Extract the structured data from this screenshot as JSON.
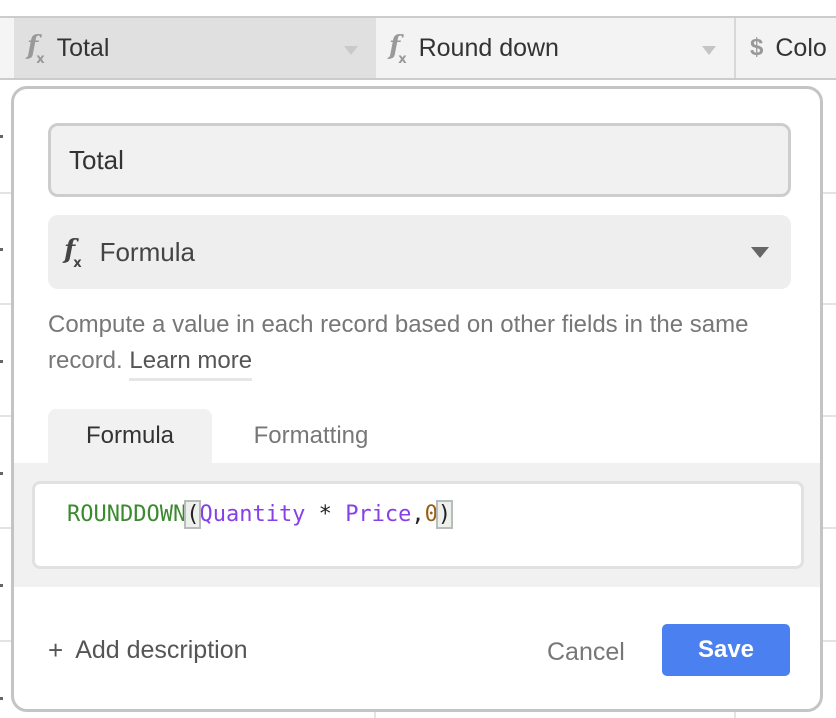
{
  "grid": {
    "columns": [
      {
        "icon": "formula-icon",
        "label": "Total",
        "selected": true
      },
      {
        "icon": "formula-icon",
        "label": "Round down"
      },
      {
        "icon": "currency-icon",
        "label": "Colo"
      }
    ],
    "fx_glyph": "f",
    "fx_sub": "x",
    "dollar_glyph": "$"
  },
  "dialog": {
    "field_name": "Total",
    "field_type": {
      "icon": "formula-icon",
      "label": "Formula"
    },
    "description": "Compute a value in each record based on other fields in the same record. ",
    "learn_more": "Learn more",
    "tabs": [
      {
        "label": "Formula",
        "active": true
      },
      {
        "label": "Formatting",
        "active": false
      }
    ],
    "formula": {
      "function": "ROUNDDOWN",
      "open": "(",
      "field1": "Quantity",
      "op": " * ",
      "field2": "Price",
      "comma": ",",
      "number": "0",
      "close": ")"
    },
    "add_description": "Add description",
    "add_icon": "+",
    "cancel_label": "Cancel",
    "save_label": "Save",
    "colors": {
      "save": "#4a80ef",
      "function": "#3a8a2e",
      "field": "#8640ea",
      "number": "#9a5e16"
    }
  }
}
